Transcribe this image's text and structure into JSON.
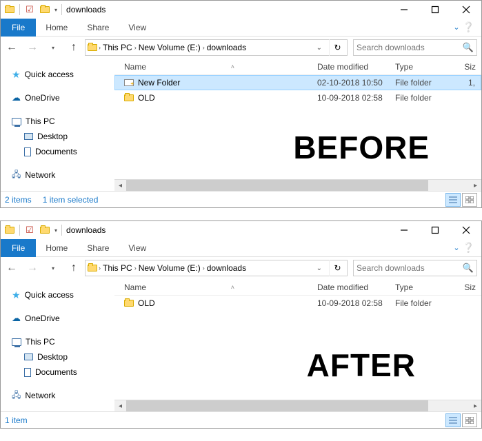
{
  "window_title": "downloads",
  "file_tab": "File",
  "tabs": [
    "Home",
    "Share",
    "View"
  ],
  "breadcrumb": [
    "This PC",
    "New Volume (E:)",
    "downloads"
  ],
  "search_placeholder": "Search downloads",
  "sidebar": {
    "quick": "Quick access",
    "onedrive": "OneDrive",
    "thispc": "This PC",
    "desktop": "Desktop",
    "documents": "Documents",
    "network": "Network"
  },
  "columns": {
    "name": "Name",
    "date": "Date modified",
    "type": "Type",
    "size": "Siz"
  },
  "before": {
    "overlay": "BEFORE",
    "rows": [
      {
        "name": "New Folder",
        "date": "02-10-2018 10:50",
        "type": "File folder",
        "size": "1,",
        "selected": true,
        "newicon": true
      },
      {
        "name": "OLD",
        "date": "10-09-2018 02:58",
        "type": "File folder",
        "size": "",
        "selected": false,
        "newicon": false
      }
    ],
    "status1": "2 items",
    "status2": "1 item selected"
  },
  "after": {
    "overlay": "AFTER",
    "rows": [
      {
        "name": "OLD",
        "date": "10-09-2018 02:58",
        "type": "File folder",
        "size": "",
        "selected": false,
        "newicon": false
      }
    ],
    "status1": "1 item",
    "status2": ""
  }
}
